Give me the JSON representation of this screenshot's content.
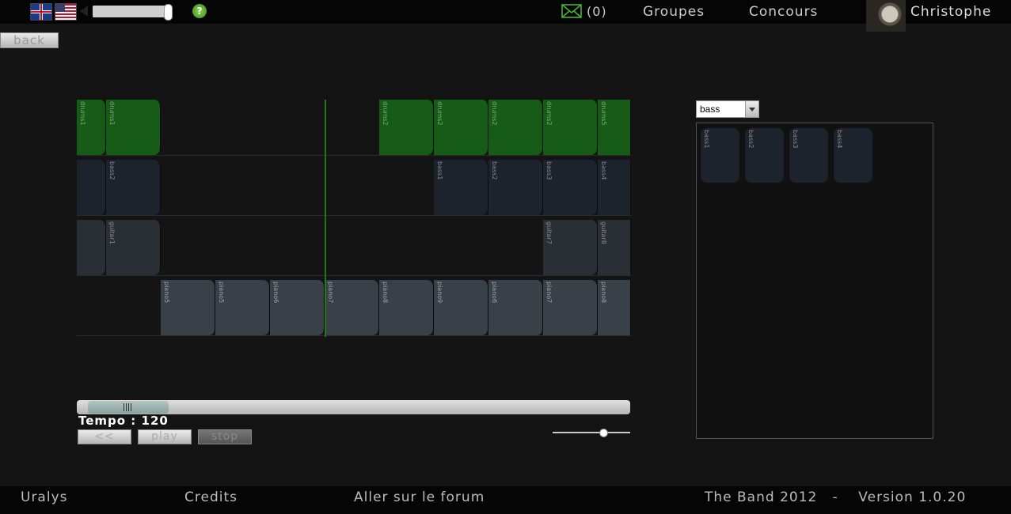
{
  "header": {
    "mail_count": "(0)",
    "nav": [
      "Groupes",
      "Concours"
    ],
    "username": "Christophe",
    "volume": 0.95,
    "help_symbol": "?"
  },
  "back_label": "back",
  "tracks": [
    {
      "color": "#165c16",
      "clips": [
        "drums1",
        "drums1",
        "drums2",
        "drums2",
        "drums2",
        "drums2",
        "drums5"
      ]
    },
    {
      "color": "#1c232c",
      "clips": [
        "bass2",
        "bass2",
        "bass1",
        "bass2",
        "bass3",
        "bass4"
      ]
    },
    {
      "color": "#2a2f36",
      "clips": [
        "guitar1",
        "guitar1",
        "guitar7",
        "guitar8"
      ]
    },
    {
      "color": "#3a4048",
      "clips": [
        "piano5",
        "piano5",
        "piano6",
        "piano7",
        "piano8",
        "piano9",
        "piano6",
        "piano7",
        "piano8"
      ]
    }
  ],
  "controls": {
    "tempo": "Tempo : 120",
    "rewind_label": "<<",
    "play_label": "play",
    "stop_label": "stop",
    "zoom": 0.65
  },
  "library": {
    "selected": "bass",
    "samples": [
      "bass1",
      "bass2",
      "bass3",
      "bass4"
    ]
  },
  "footer": {
    "uralys": "Uralys",
    "credits": "Credits",
    "forum": "Aller sur le forum",
    "copyright": "The Band 2012   -    Version 1.0.20"
  }
}
